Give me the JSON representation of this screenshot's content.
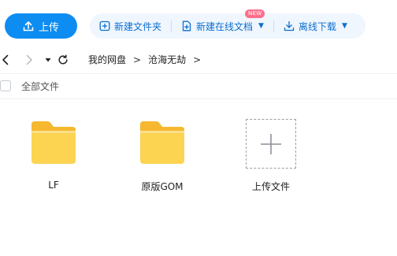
{
  "toolbar": {
    "upload_label": "上传",
    "new_folder_label": "新建文件夹",
    "new_online_doc_label": "新建在线文档",
    "new_badge": "NEW",
    "offline_download_label": "离线下载"
  },
  "breadcrumb": {
    "root": "我的网盘",
    "current": "沧海无劫",
    "separator": ">"
  },
  "list_header": {
    "all_files_label": "全部文件"
  },
  "items": [
    {
      "name": "LF",
      "type": "folder"
    },
    {
      "name": "原版GOM",
      "type": "folder"
    },
    {
      "name": "上传文件",
      "type": "upload"
    }
  ],
  "colors": {
    "accent": "#0d8cf2",
    "action_text": "#0d6fcf",
    "folder_yellow": "#fdd352",
    "badge": "#ff6f8a"
  }
}
